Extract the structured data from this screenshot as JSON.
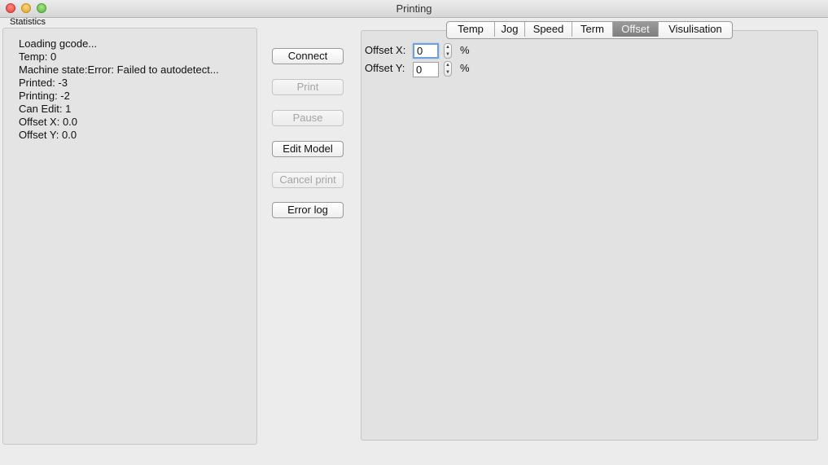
{
  "window": {
    "title": "Printing"
  },
  "stats": {
    "label": "Statistics",
    "lines": [
      "Loading gcode...",
      "Temp: 0",
      "Machine state:Error: Failed to autodetect...",
      "Printed: -3",
      "Printing: -2",
      "Can Edit: 1",
      "Offset X: 0.0",
      "Offset Y: 0.0"
    ]
  },
  "controls": {
    "connect": "Connect",
    "print": "Print",
    "pause": "Pause",
    "edit_model": "Edit Model",
    "cancel_print": "Cancel print",
    "error_log": "Error log"
  },
  "tabs": [
    "Temp",
    "Jog",
    "Speed",
    "Term",
    "Offset",
    "Visulisation"
  ],
  "active_tab": "Offset",
  "offset": {
    "x_label": "Offset X:",
    "x_value": "0",
    "y_label": "Offset Y:",
    "y_value": "0",
    "unit": "%"
  },
  "colors": {
    "active_tab": "#8a8a8a",
    "focus_ring": "#6f9fdc"
  }
}
